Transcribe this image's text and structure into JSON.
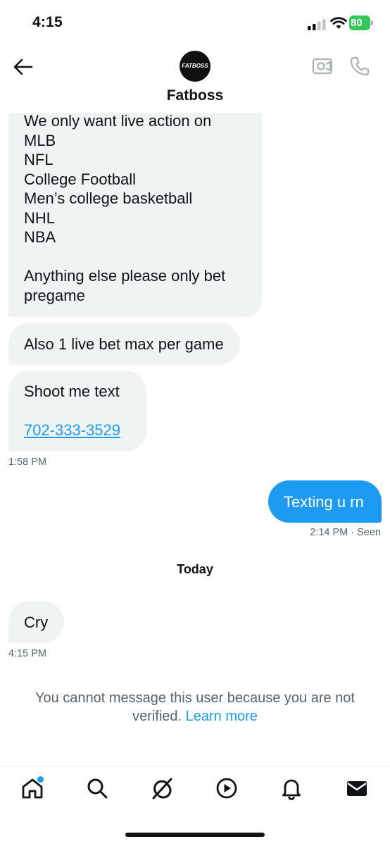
{
  "status_bar": {
    "time": "4:15",
    "battery": "80"
  },
  "header": {
    "contact_name": "Fatboss",
    "avatar_text": "FATBOSS"
  },
  "messages": [
    {
      "lines": [
        "We only want live action on",
        "MLB",
        "NFL",
        "College Football",
        "Men’s college basketball",
        "NHL",
        "NBA",
        "",
        "Anything else please only bet",
        "pregame"
      ]
    },
    {
      "lines": [
        "Also 1 live bet max per game"
      ]
    },
    {
      "lines": [
        "Shoot me text",
        ""
      ],
      "link": "702-333-3529",
      "time": "1:58 PM"
    },
    {
      "lines": [
        "Texting u rn"
      ],
      "time": "2:14 PM",
      "status": "· Seen"
    },
    {
      "lines": [
        "Cry"
      ],
      "time": "4:15 PM"
    }
  ],
  "day_separator": "Today",
  "notice": {
    "text": "You cannot message this user because you are not verified.",
    "link": "Learn more"
  },
  "colors": {
    "accent": "#1d9bf0",
    "incoming_bubble": "#eff3f4",
    "meta_text": "#536471",
    "battery": "#34c759"
  },
  "icons": {
    "header": [
      "back-arrow-icon",
      "video-camera-icon",
      "phone-icon"
    ],
    "tabs": [
      "home-icon",
      "search-icon",
      "grok-icon",
      "play-icon",
      "bell-icon",
      "envelope-icon"
    ]
  }
}
